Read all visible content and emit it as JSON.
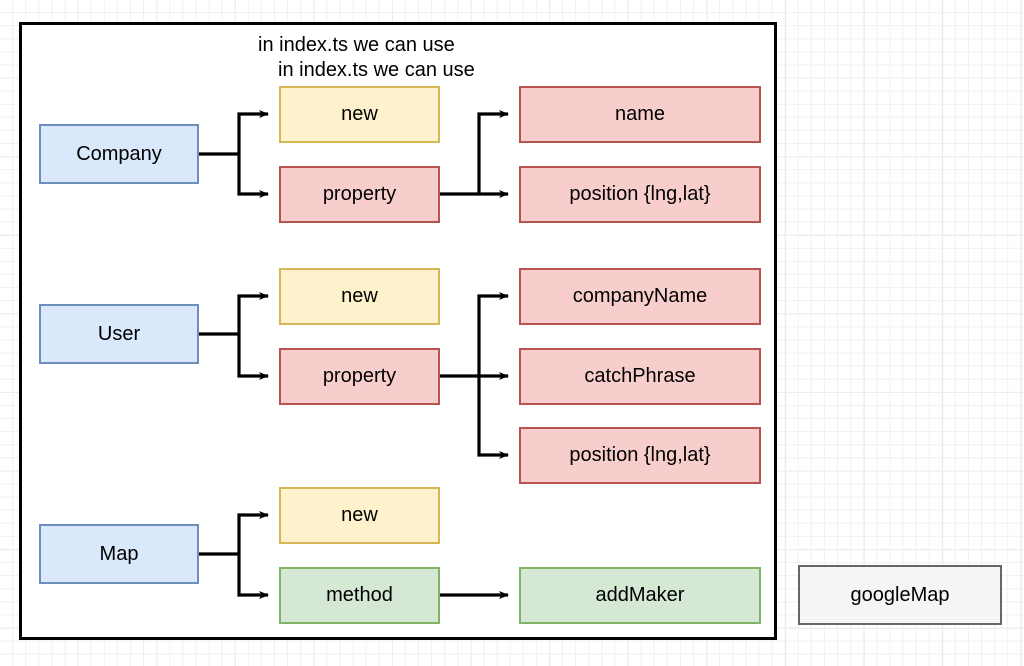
{
  "diagram": {
    "notes": [
      {
        "text": "in index.ts we can use"
      },
      {
        "text": "in index.ts we can use"
      }
    ],
    "colors": {
      "blue_fill": "#dae8fc",
      "blue_stroke": "#6c8ebf",
      "yellow_fill": "#fdf2cc",
      "yellow_stroke": "#d6b656",
      "pink_fill": "#f8cecc",
      "pink_stroke": "#b85450",
      "green_fill": "#d5e8d4",
      "green_stroke": "#82b366",
      "gray_fill": "#f5f5f5",
      "gray_stroke": "#666666",
      "edge": "#000000",
      "container_border": "#000000",
      "grid_minor": "#f0f0f0",
      "grid_major": "#dcdcdc"
    },
    "groups": [
      {
        "id": "company",
        "entity": "Company",
        "kinds": [
          {
            "label": "new",
            "color": "yellow"
          },
          {
            "label": "property",
            "color": "pink"
          }
        ],
        "members": [
          {
            "label": "name",
            "color": "pink"
          },
          {
            "label": "position {lng,lat}",
            "color": "pink"
          }
        ]
      },
      {
        "id": "user",
        "entity": "User",
        "kinds": [
          {
            "label": "new",
            "color": "yellow"
          },
          {
            "label": "property",
            "color": "pink"
          }
        ],
        "members": [
          {
            "label": "companyName",
            "color": "pink"
          },
          {
            "label": "catchPhrase",
            "color": "pink"
          },
          {
            "label": "position {lng,lat}",
            "color": "pink"
          }
        ]
      },
      {
        "id": "map",
        "entity": "Map",
        "kinds": [
          {
            "label": "new",
            "color": "yellow"
          },
          {
            "label": "method",
            "color": "green"
          }
        ],
        "members": [
          {
            "label": "addMaker",
            "color": "green"
          }
        ]
      }
    ],
    "aside": {
      "label": "googleMap",
      "color": "gray"
    }
  }
}
